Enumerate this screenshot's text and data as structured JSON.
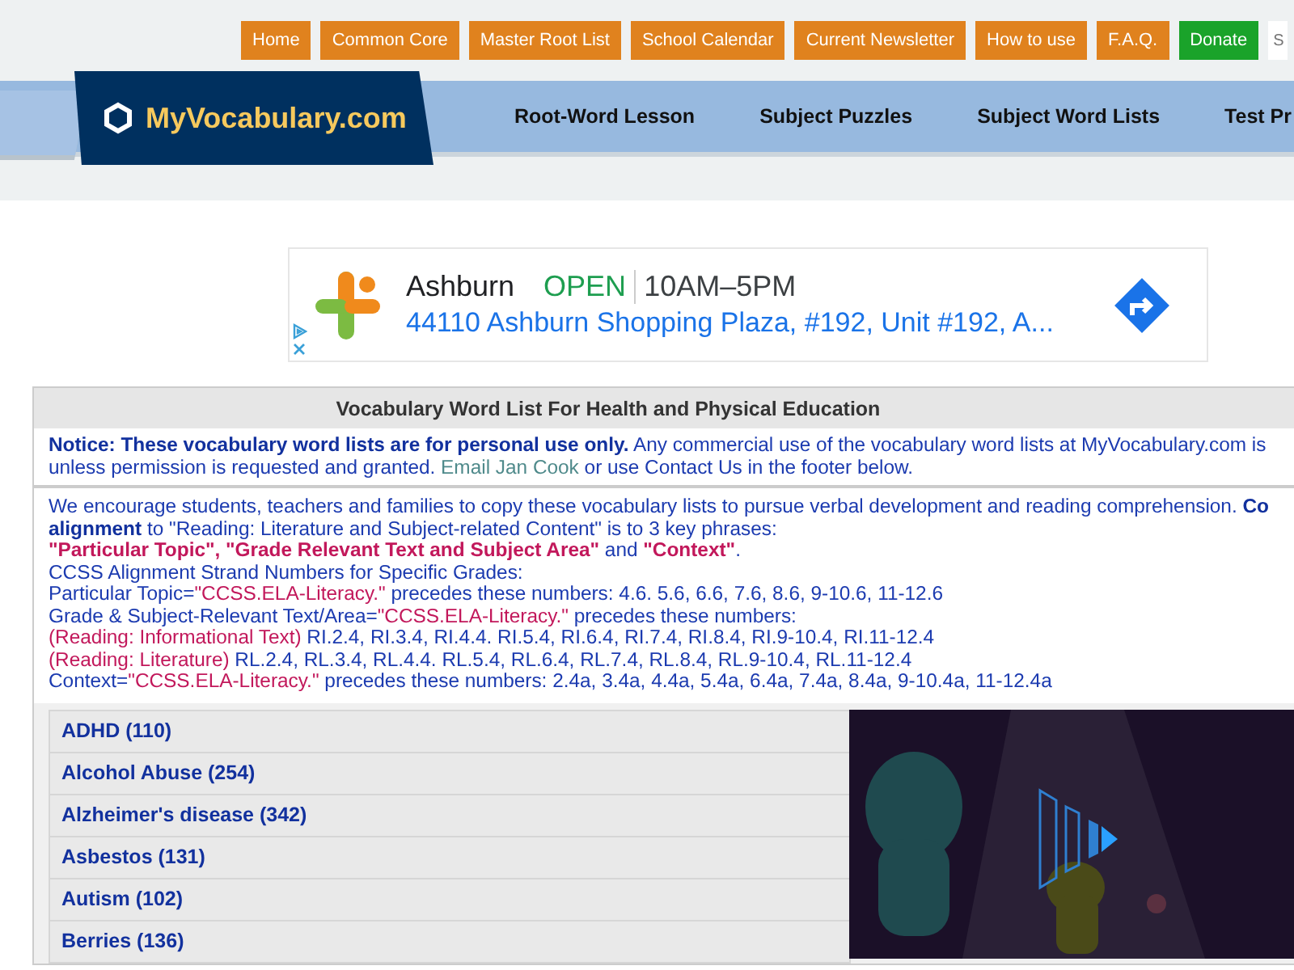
{
  "top_links": [
    {
      "label": "Home",
      "kind": "orange"
    },
    {
      "label": "Common Core",
      "kind": "orange"
    },
    {
      "label": "Master Root List",
      "kind": "orange"
    },
    {
      "label": "School Calendar",
      "kind": "orange"
    },
    {
      "label": "Current Newsletter",
      "kind": "orange"
    },
    {
      "label": "How to use",
      "kind": "orange"
    },
    {
      "label": "F.A.Q.",
      "kind": "orange"
    },
    {
      "label": "Donate",
      "kind": "green"
    }
  ],
  "search": {
    "placeholder": "S"
  },
  "logo": {
    "text": "MyVocabulary.com"
  },
  "nav": [
    "Root-Word Lesson",
    "Subject Puzzles",
    "Subject Word Lists",
    "Test Pr"
  ],
  "ad": {
    "name": "Ashburn",
    "status": "OPEN",
    "hours": "10AM–5PM",
    "address": "44110 Ashburn Shopping Plaza, #192, Unit #192, A..."
  },
  "panel": {
    "title": "Vocabulary Word List For Health and Physical Education",
    "notice": [
      [
        {
          "t": "Notice: These vocabulary word lists are for personal use only.",
          "kind": "bold"
        },
        {
          "t": " Any commercial use of the vocabulary word lists at MyVocabulary.com is",
          "kind": "plain"
        }
      ],
      [
        {
          "t": "unless permission is requested and granted. ",
          "kind": "plain"
        },
        {
          "t": "Email Jan Cook",
          "kind": "link"
        },
        {
          "t": " or use Contact Us in the footer below.",
          "kind": "plain"
        }
      ]
    ],
    "info": [
      [
        {
          "t": "We encourage students, teachers and families to copy these vocabulary lists to pursue verbal development and reading comprehension. ",
          "kind": "plain"
        },
        {
          "t": "Co",
          "kind": "bold"
        }
      ],
      [
        {
          "t": "alignment",
          "kind": "bold"
        },
        {
          "t": " to \"Reading: Literature and Subject-related Content\" is to 3 key phrases:",
          "kind": "plain"
        }
      ],
      [
        {
          "t": "\"Particular Topic\", \"Grade Relevant Text and Subject Area\"",
          "kind": "redbold"
        },
        {
          "t": " and ",
          "kind": "plain"
        },
        {
          "t": "\"Context\"",
          "kind": "redbold"
        },
        {
          "t": ".",
          "kind": "plain"
        }
      ],
      [
        {
          "t": "CCSS Alignment Strand Numbers for Specific Grades:",
          "kind": "plain"
        }
      ],
      [
        {
          "t": "Particular Topic=",
          "kind": "plain"
        },
        {
          "t": "\"CCSS.ELA-Literacy.\"",
          "kind": "red"
        },
        {
          "t": " precedes these numbers: 4.6. 5.6, 6.6, 7.6, 8.6, 9-10.6, 11-12.6",
          "kind": "plain"
        }
      ],
      [
        {
          "t": "Grade & Subject-Relevant Text/Area=",
          "kind": "plain"
        },
        {
          "t": "\"CCSS.ELA-Literacy.\"",
          "kind": "red"
        },
        {
          "t": " precedes these numbers:",
          "kind": "plain"
        }
      ],
      [
        {
          "t": "(Reading: Informational Text)",
          "kind": "red"
        },
        {
          "t": " RI.2.4, RI.3.4, RI.4.4. RI.5.4, RI.6.4, RI.7.4, RI.8.4, RI.9-10.4, RI.11-12.4",
          "kind": "plain"
        }
      ],
      [
        {
          "t": "(Reading: Literature)",
          "kind": "red"
        },
        {
          "t": " RL.2.4, RL.3.4, RL.4.4. RL.5.4, RL.6.4, RL.7.4, RL.8.4, RL.9-10.4, RL.11-12.4",
          "kind": "plain"
        }
      ],
      [
        {
          "t": "Context=",
          "kind": "plain"
        },
        {
          "t": "\"CCSS.ELA-Literacy.\"",
          "kind": "red"
        },
        {
          "t": " precedes these numbers: 2.4a, 3.4a, 4.4a, 5.4a, 6.4a, 7.4a, 8.4a, 9-10.4a, 11-12.4a",
          "kind": "plain"
        }
      ]
    ],
    "topics": [
      "ADHD (110)",
      "Alcohol Abuse (254)",
      "Alzheimer's disease (342)",
      "Asbestos (131)",
      "Autism (102)",
      "Berries (136)"
    ]
  }
}
